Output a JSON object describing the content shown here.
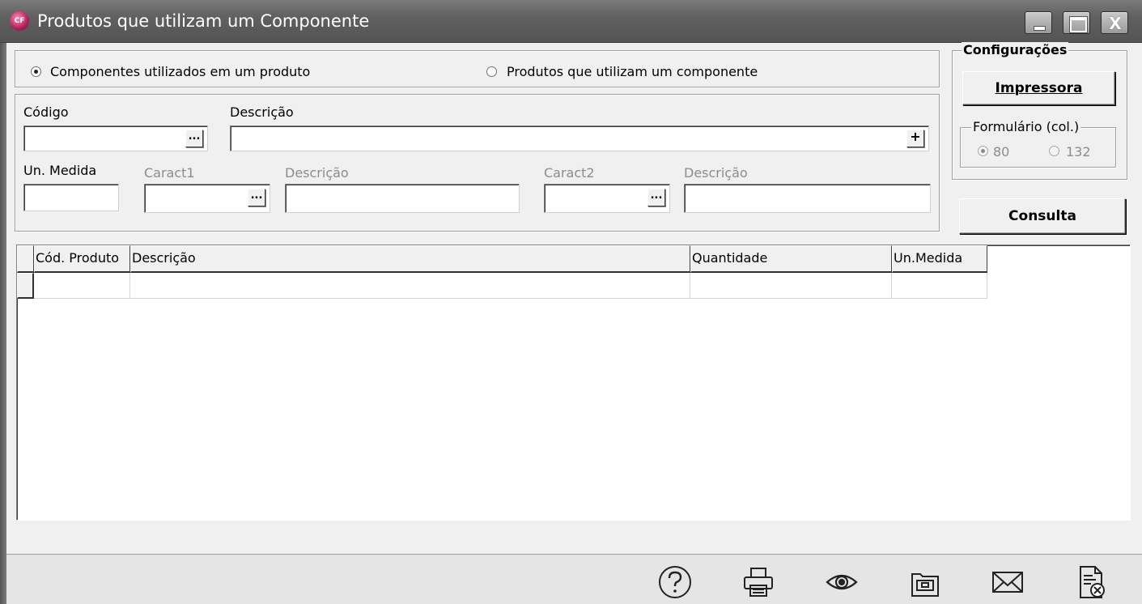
{
  "window": {
    "title": "Produtos que utilizam um Componente",
    "app_icon_text": "CF",
    "close_glyph": "X"
  },
  "mode": {
    "option1": "Componentes utilizados em um produto",
    "option2": "Produtos que utilizam um componente",
    "selected": "option1"
  },
  "filters": {
    "codigo_label": "Código",
    "descricao_label": "Descrição",
    "un_medida_label": "Un. Medida",
    "caract1_label": "Caract1",
    "caract1_desc_label": "Descrição",
    "caract2_label": "Caract2",
    "caract2_desc_label": "Descrição",
    "codigo_value": "",
    "descricao_value": "",
    "un_medida_value": "",
    "caract1_value": "",
    "caract1_desc_value": "",
    "caract2_value": "",
    "caract2_desc_value": "",
    "ellipsis": "...",
    "plus": "+"
  },
  "config": {
    "title": "Configurações",
    "printer_button": "Impressora",
    "form_label": "Formulário (col.)",
    "col80": "80",
    "col132": "132",
    "selected": "80"
  },
  "actions": {
    "consulta": "Consulta"
  },
  "grid": {
    "columns": [
      "Cód. Produto",
      "Descrição",
      "Quantidade",
      "Un.Medida"
    ],
    "rows": [
      [
        "",
        "",
        "",
        ""
      ]
    ]
  },
  "toolbar": {
    "icons": [
      "help-icon",
      "printer-icon",
      "preview-icon",
      "export-icon",
      "email-icon",
      "close-report-icon"
    ]
  },
  "colors": {
    "titlebar": "#606060",
    "background": "#f0f0f0",
    "disabled_text": "#8c8c8c"
  }
}
